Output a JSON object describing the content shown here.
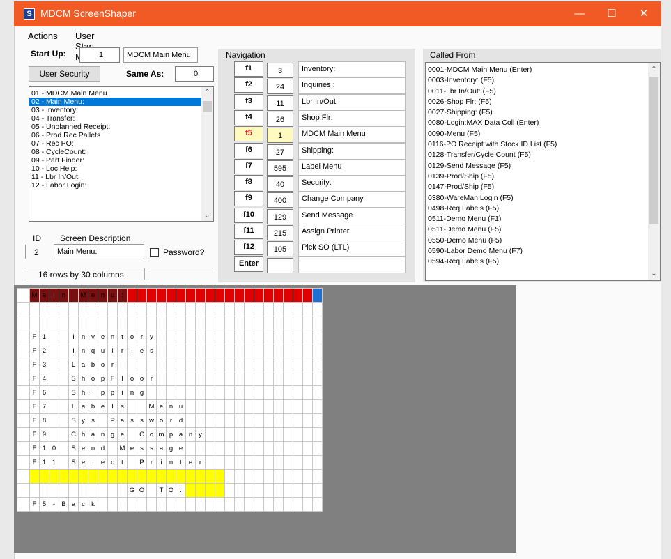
{
  "window": {
    "title": "MDCM ScreenShaper",
    "app_icon": "S",
    "min_icon": "minimize-icon",
    "max_icon": "maximize-icon",
    "close_icon": "close-icon"
  },
  "menu": [
    "Actions",
    "User Start Menus"
  ],
  "startup": {
    "label": "Start Up:",
    "value": "1",
    "menu_name": "MDCM Main Menu"
  },
  "user_security_button": "User Security",
  "same_as": {
    "label": "Same As:",
    "value": "0"
  },
  "screens": [
    "01 - MDCM Main Menu",
    "02 - Main Menu:",
    "03 - Inventory:",
    "04 - Transfer:",
    "05 - Unplanned Receipt:",
    "06 - Prod Rec Pallets",
    "07 - Rec PO:",
    "08 - CycleCount:",
    "09 - Part Finder:",
    "10 - Loc Help:",
    "11 - Lbr In/Out:",
    "12 - Labor Login:"
  ],
  "selected_screen_index": 1,
  "id_label": "ID",
  "description_label": "Screen Description",
  "screen_id": "2",
  "screen_description": "Main Menu:",
  "password_label": "Password?",
  "size_text": "16 rows by 30 columns",
  "navigation": {
    "title": "Navigation",
    "keys": [
      {
        "key": "f1",
        "num": "3",
        "label": "Inventory:"
      },
      {
        "key": "f2",
        "num": "24",
        "label": "Inquiries :"
      },
      {
        "key": "f3",
        "num": "11",
        "label": "Lbr In/Out:"
      },
      {
        "key": "f4",
        "num": "26",
        "label": "Shop Flr:"
      },
      {
        "key": "f5",
        "num": "1",
        "label": "MDCM Main Menu"
      },
      {
        "key": "f6",
        "num": "27",
        "label": "Shipping:"
      },
      {
        "key": "f7",
        "num": "595",
        "label": "Label Menu"
      },
      {
        "key": "f8",
        "num": "40",
        "label": "Security:"
      },
      {
        "key": "f9",
        "num": "400",
        "label": "Change Company"
      },
      {
        "key": "f10",
        "num": "129",
        "label": "Send Message"
      },
      {
        "key": "f11",
        "num": "215",
        "label": "Assign Printer"
      },
      {
        "key": "f12",
        "num": "105",
        "label": "Pick SO (LTL)"
      },
      {
        "key": "Enter",
        "num": "",
        "label": ""
      }
    ],
    "highlighted_key_index": 4
  },
  "called_from": {
    "title": "Called From",
    "items": [
      "0001-MDCM Main Menu (Enter)",
      "0003-Inventory: (F5)",
      "0011-Lbr In/Out: (F5)",
      "0026-Shop Flr: (F5)",
      "0027-Shipping: (F5)",
      "0080-Login:MAX Data Coll (Enter)",
      "0090-Menu (F5)",
      "0116-PO Receipt with Stock  ID List (F5)",
      "0128-Transfer/Cycle Count (F5)",
      "0129-Send Message (F5)",
      "0139-Prod/Ship (F5)",
      "0147-Prod/Ship (F5)",
      "0380-WareMan Login (F5)",
      "0498-Req Labels (F5)",
      "0511-Demo Menu (F1)",
      "0511-Demo Menu (F5)",
      "0550-Demo Menu (F5)",
      "0590-Labor Demo Menu (F7)",
      "0594-Req Labels (F5)"
    ]
  },
  "screen_grid": {
    "rows": [
      "Main Menu:",
      "",
      "",
      "F1  Inventory",
      "F2  Inquiries",
      "F3  Labor",
      "F4  ShopFloor",
      "F6  Shipping",
      "F7  Labels  Menu",
      "F8  Sys Password",
      "F9  Change Company",
      "F10 Send Message",
      "F11 Select Printer",
      "",
      "          GO TO:",
      "F5-Back"
    ],
    "colors": {
      "title_bar": "#e00000",
      "title_chars": "#7a0f0f",
      "input_fill": "#ffff00",
      "cursor": "#1e6fd4"
    }
  }
}
